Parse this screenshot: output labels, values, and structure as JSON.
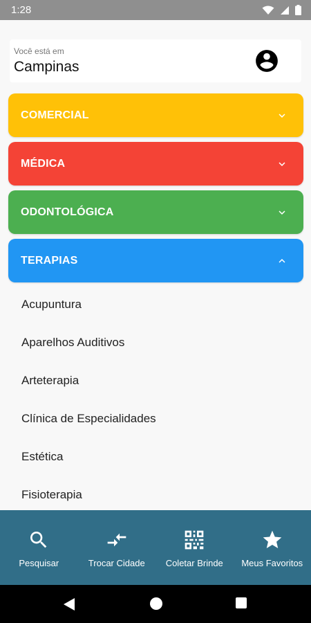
{
  "status_bar": {
    "time": "1:28"
  },
  "location": {
    "label": "Você está em",
    "city": "Campinas"
  },
  "categories": [
    {
      "label": "COMERCIAL",
      "color": "#ffc107",
      "expanded": false
    },
    {
      "label": "MÉDICA",
      "color": "#f44336",
      "expanded": false
    },
    {
      "label": "ODONTOLÓGICA",
      "color": "#4caf50",
      "expanded": false
    },
    {
      "label": "TERAPIAS",
      "color": "#2196f3",
      "expanded": true
    }
  ],
  "terapias_items": [
    "Acupuntura",
    "Aparelhos Auditivos",
    "Arteterapia",
    "Clínica de Especialidades",
    "Estética",
    "Fisioterapia"
  ],
  "bottom_nav": [
    {
      "label": "Pesquisar",
      "icon": "search-icon"
    },
    {
      "label": "Trocar Cidade",
      "icon": "swap-icon"
    },
    {
      "label": "Coletar Brinde",
      "icon": "qr-code-icon"
    },
    {
      "label": "Meus Favoritos",
      "icon": "star-icon"
    }
  ],
  "colors": {
    "bottom_nav_bg": "#316e88",
    "status_bar_bg": "#8f8f8f"
  }
}
